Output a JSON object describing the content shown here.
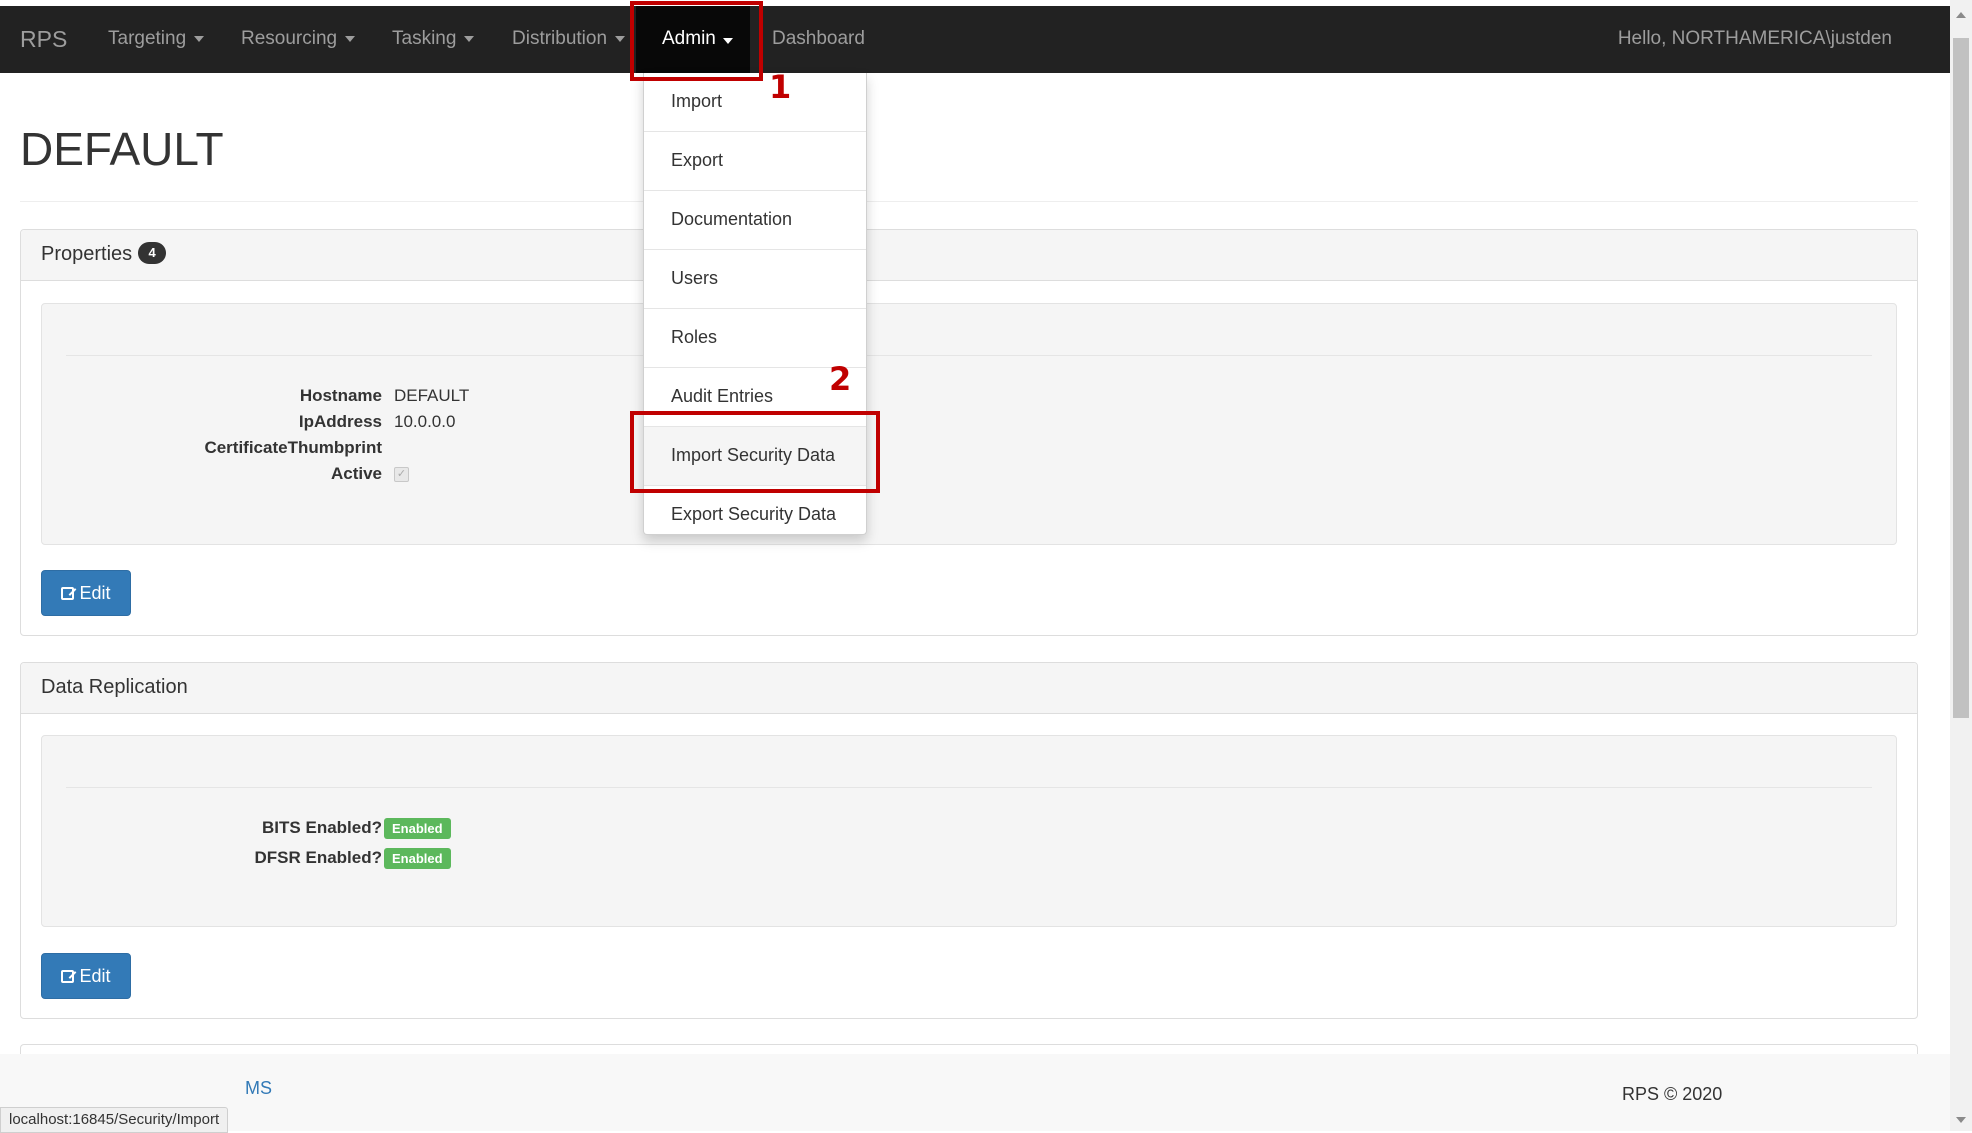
{
  "navbar": {
    "brand": "RPS",
    "items": [
      {
        "label": "Targeting"
      },
      {
        "label": "Resourcing"
      },
      {
        "label": "Tasking"
      },
      {
        "label": "Distribution"
      },
      {
        "label": "Admin"
      },
      {
        "label": "Dashboard"
      }
    ],
    "greeting": "Hello, NORTHAMERICA\\justden"
  },
  "admin_menu": {
    "items": [
      {
        "label": "Import"
      },
      {
        "label": "Export"
      },
      {
        "label": "Documentation"
      },
      {
        "label": "Users"
      },
      {
        "label": "Roles"
      },
      {
        "label": "Audit Entries"
      },
      {
        "label": "Import Security Data"
      },
      {
        "label": "Export Security Data"
      }
    ],
    "highlighted": "Import Security Data"
  },
  "annotations": {
    "step1": "1",
    "step2": "2",
    "color": "#c00000"
  },
  "page": {
    "title": "DEFAULT"
  },
  "properties_panel": {
    "title": "Properties",
    "count": "4",
    "fields": [
      {
        "label": "Hostname",
        "value": "DEFAULT"
      },
      {
        "label": "IpAddress",
        "value": "10.0.0.0"
      },
      {
        "label": "CertificateThumbprint",
        "value": ""
      },
      {
        "label": "Active",
        "value": ""
      }
    ],
    "active_checked": true,
    "edit_label": "Edit"
  },
  "replication_panel": {
    "title": "Data Replication",
    "fields": [
      {
        "label": "BITS Enabled?",
        "badge": "Enabled"
      },
      {
        "label": "DFSR Enabled?",
        "badge": "Enabled"
      }
    ],
    "edit_label": "Edit"
  },
  "footer": {
    "link": "MS",
    "copyright": "RPS © 2020"
  },
  "status_bar": {
    "url": "localhost:16845/Security/Import"
  },
  "colors": {
    "navbar_bg": "#222222",
    "primary": "#337ab7",
    "success": "#5cb85c"
  }
}
